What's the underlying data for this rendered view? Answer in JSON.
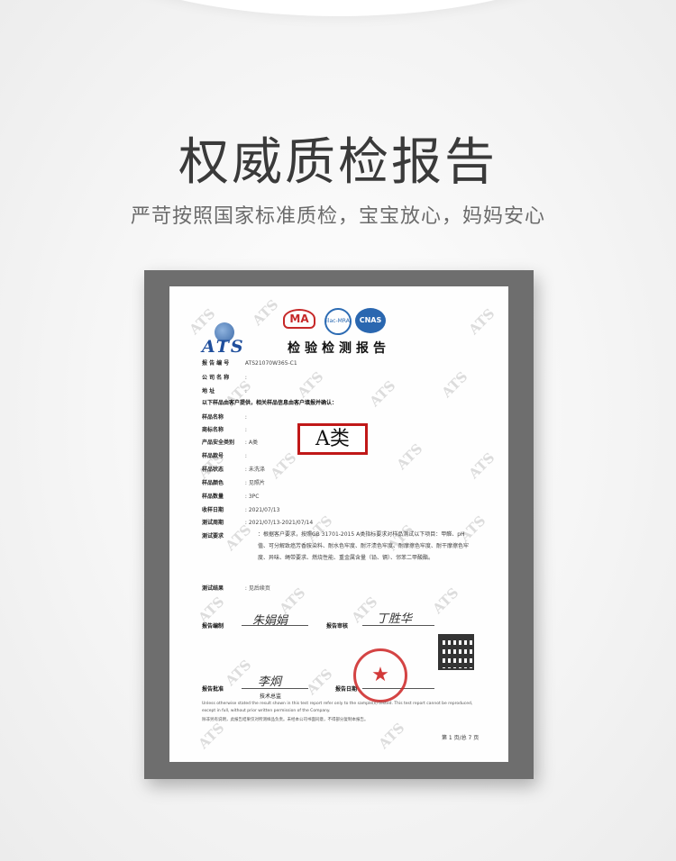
{
  "title": "权威质检报告",
  "subtitle": "严苛按照国家标准质检，宝宝放心，妈妈安心",
  "certificate": {
    "logo_text": "ATS",
    "watermark_text": "ATS",
    "ma_logo": "MA",
    "ilac_logo": "ilac-MRA",
    "cnas_logo": "CNAS",
    "heading": "检验检测报告",
    "report_no_label": "报 告 编 号",
    "report_no": "ATS21070W365-C1",
    "fields": [
      {
        "label": "公 司 名 称",
        "value": ":"
      },
      {
        "label": "地      址",
        "value": ":"
      },
      {
        "label": "样品名称",
        "value": ":"
      },
      {
        "label": "商标名称",
        "value": ":"
      },
      {
        "label": "产品安全类别",
        "value": ": A类"
      },
      {
        "label": "样品款号",
        "value": ":"
      },
      {
        "label": "样品状态",
        "value": ": 未洗涤"
      },
      {
        "label": "样品颜色",
        "value": ": 见照片"
      },
      {
        "label": "样品数量",
        "value": ": 3PC"
      },
      {
        "label": "收样日期",
        "value": ": 2021/07/13"
      },
      {
        "label": "测试周期",
        "value": ": 2021/07/13-2021/07/14"
      }
    ],
    "client_note": "以下样品由客户提供，相关样品信息由客户填报并确认：",
    "test_req_label": "测试要求",
    "test_req_text": "：根据客户要求，按照GB 31701-2015 A类指标要求对样品测试以下项目：甲醛、pH值、可分解致癌芳香胺染料、耐水色牢度、耐汗渍色牢度、耐摩擦色牢度、耐干摩擦色牢度、异味、绳带要求、燃烧性能、重金属含量（铅、镉）、邻苯二甲酸酯。",
    "test_result_label": "测试结果",
    "test_result_value": ": 见后续页",
    "highlight_label": "A类",
    "prepared_label": "报告编制",
    "prepared_sign": "朱娟娟",
    "reviewed_label": "报告审核",
    "reviewed_sign": "丁胜华",
    "approved_label": "报告批准",
    "approved_sign": "李炯",
    "approved_title": "技术总监",
    "issue_label": "报告日期",
    "footer_en": "Unless otherwise stated the result shown in this test report refer only to the sample(s) tested. This test report cannot be reproduced, except in full, without prior written permission of the Company.",
    "footer_cn": "除非另有说明，此报告结果仅对所测样品负责。未经本公司书面同意，不得部分复制本报告。",
    "page_label": "第 1 页/总 7 页"
  },
  "colors": {
    "highlight_border": "#c01818",
    "frame": "#6e6e6e",
    "seal": "#cd2323",
    "ats_blue": "#1f4e9c"
  }
}
